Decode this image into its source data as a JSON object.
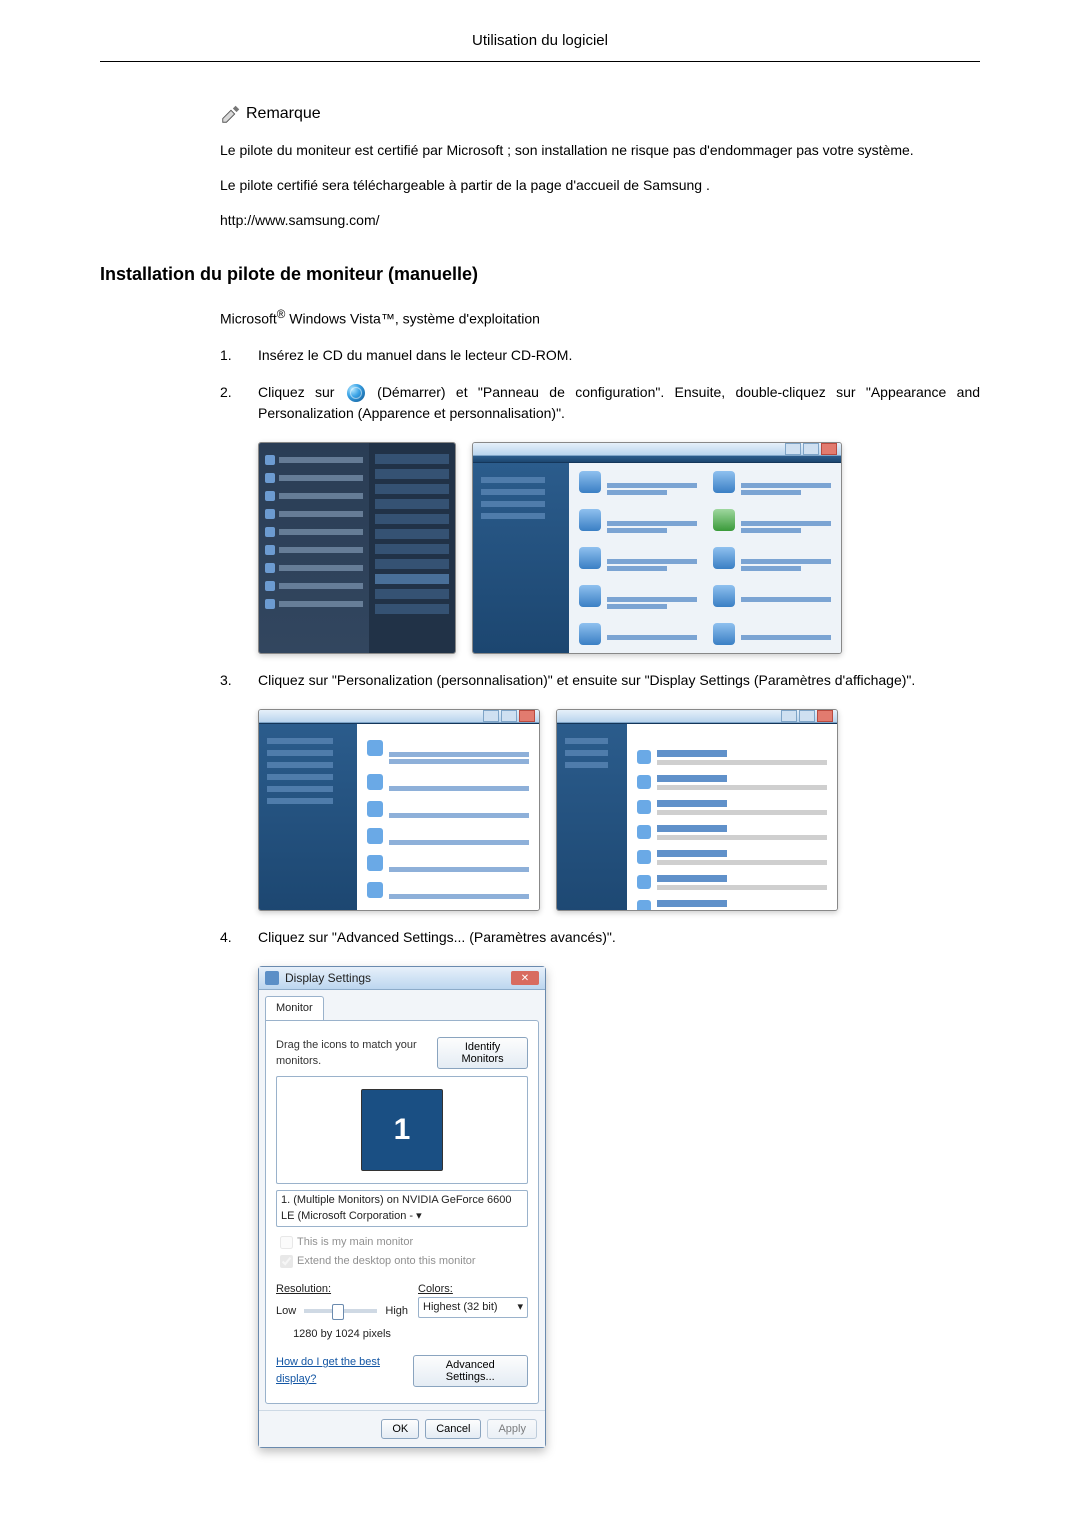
{
  "header": {
    "title": "Utilisation du logiciel"
  },
  "remarque": {
    "label": "Remarque",
    "p1": "Le pilote du moniteur est certifié par Microsoft ; son installation ne risque pas d'endommager pas votre système.",
    "p2": "Le pilote certifié sera téléchargeable à partir de la page d'accueil de Samsung .",
    "url": "http://www.samsung.com/"
  },
  "section": {
    "title": "Installation du pilote de moniteur (manuelle)",
    "os_line_prefix": "Microsoft",
    "os_line_mid": " Windows Vista",
    "os_line_suffix": ", système d'exploitation",
    "steps": [
      {
        "n": "1.",
        "text": "Insérez le CD du manuel dans le lecteur CD-ROM."
      },
      {
        "n": "2.",
        "pre": "Cliquez sur",
        "post": "(Démarrer) et \"Panneau de configuration\". Ensuite, double-cliquez sur \"Appearance and Personalization (Apparence et personnalisation)\"."
      },
      {
        "n": "3.",
        "text": "Cliquez sur \"Personalization (personnalisation)\" et ensuite sur \"Display Settings (Paramètres d'affichage)\"."
      },
      {
        "n": "4.",
        "text": "Cliquez sur \"Advanced Settings... (Paramètres avancés)\"."
      }
    ]
  },
  "dialog": {
    "title": "Display Settings",
    "tab": "Monitor",
    "drag_hint": "Drag the icons to match your monitors.",
    "identify_btn": "Identify Monitors",
    "monitor_number": "1",
    "monitor_select": "1. (Multiple Monitors) on NVIDIA GeForce 6600 LE (Microsoft Corporation - ▾",
    "cb_main": "This is my main monitor",
    "cb_extend": "Extend the desktop onto this monitor",
    "res_label": "Resolution:",
    "res_low": "Low",
    "res_high": "High",
    "res_value": "1280 by 1024 pixels",
    "colors_label": "Colors:",
    "colors_value": "Highest (32 bit)",
    "best_display_link": "How do I get the best display?",
    "advanced_btn": "Advanced Settings...",
    "ok": "OK",
    "cancel": "Cancel",
    "apply": "Apply"
  }
}
